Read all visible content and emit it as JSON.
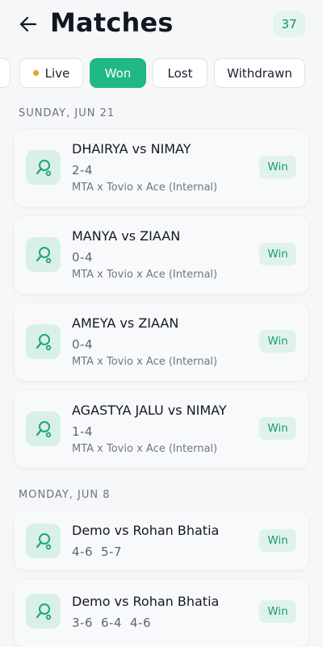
{
  "header": {
    "title": "Matches",
    "count": "37"
  },
  "tabs": [
    {
      "label": ""
    },
    {
      "label": "Live"
    },
    {
      "label": "Won"
    },
    {
      "label": "Lost"
    },
    {
      "label": "Withdrawn"
    }
  ],
  "active_tab": "Won",
  "colors": {
    "accent": "#20b883",
    "live_dot": "#e8a11f",
    "badge_bg": "#dff3eb",
    "badge_text": "#1a9a70"
  },
  "groups": [
    {
      "date": "SUNDAY, JUN 21",
      "matches": [
        {
          "title": "DHAIRYA vs NIMAY",
          "scores": [
            "2-4"
          ],
          "event": "MTA x Tovio x Ace (Internal)",
          "result": "Win",
          "icon": "tennis-racket-icon"
        },
        {
          "title": "MANYA vs ZIAAN",
          "scores": [
            "0-4"
          ],
          "event": "MTA x Tovio x Ace (Internal)",
          "result": "Win",
          "icon": "tennis-racket-icon"
        },
        {
          "title": "AMEYA vs ZIAAN",
          "scores": [
            "0-4"
          ],
          "event": "MTA x Tovio x Ace (Internal)",
          "result": "Win",
          "icon": "tennis-racket-icon"
        },
        {
          "title": "AGASTYA JALU vs NIMAY",
          "scores": [
            "1-4"
          ],
          "event": "MTA x Tovio x Ace (Internal)",
          "result": "Win",
          "icon": "tennis-racket-icon"
        }
      ]
    },
    {
      "date": "MONDAY, JUN 8",
      "matches": [
        {
          "title": "Demo vs Rohan Bhatia",
          "scores": [
            "4-6",
            "5-7"
          ],
          "result": "Win",
          "icon": "tennis-racket-icon"
        },
        {
          "title": "Demo vs Rohan Bhatia",
          "scores": [
            "3-6",
            "6-4",
            "4-6"
          ],
          "result": "Win",
          "icon": "tennis-racket-icon"
        }
      ]
    }
  ]
}
